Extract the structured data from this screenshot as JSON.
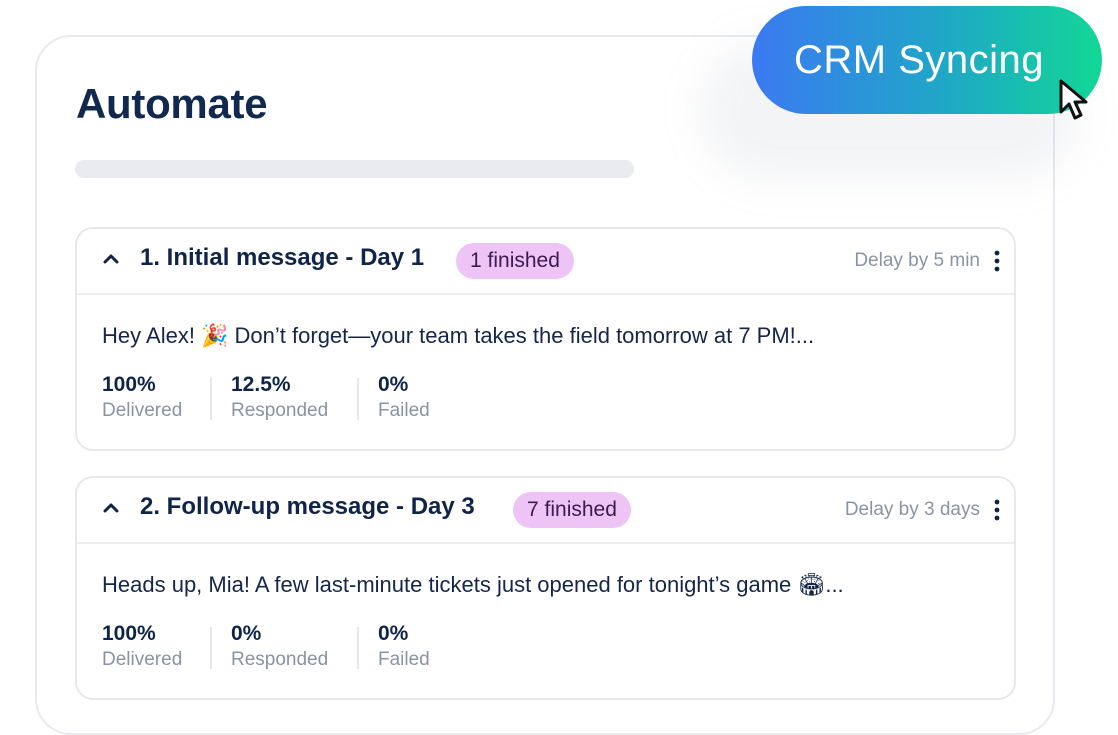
{
  "title": "Automate",
  "crm_button_label": "CRM Syncing",
  "steps": [
    {
      "title": "1. Initial message - Day 1",
      "badge": "1 finished",
      "delay": "Delay by 5 min",
      "message": "Hey Alex! 🎉 Don’t forget—your team takes the field tomorrow at 7 PM!...",
      "stats": [
        {
          "value": "100%",
          "label": "Delivered"
        },
        {
          "value": "12.5%",
          "label": "Responded"
        },
        {
          "value": "0%",
          "label": "Failed"
        }
      ]
    },
    {
      "title": "2. Follow-up message - Day 3",
      "badge": "7 finished",
      "delay": "Delay by 3 days",
      "message": "Heads up, Mia! A few last-minute tickets just opened for tonight’s game 🏟...",
      "stats": [
        {
          "value": "100%",
          "label": "Delivered"
        },
        {
          "value": "0%",
          "label": "Responded"
        },
        {
          "value": "0%",
          "label": "Failed"
        }
      ]
    }
  ],
  "icons": {
    "collapse": "chevron-up-icon",
    "menu": "more-vertical-icon",
    "pointer": "cursor-arrow-icon"
  },
  "colors": {
    "title": "#11284f",
    "badge_bg": "#eec3f6",
    "muted_text": "#8a93a4",
    "crm_gradient_start": "#3b7af2",
    "crm_gradient_end": "#12d796"
  }
}
